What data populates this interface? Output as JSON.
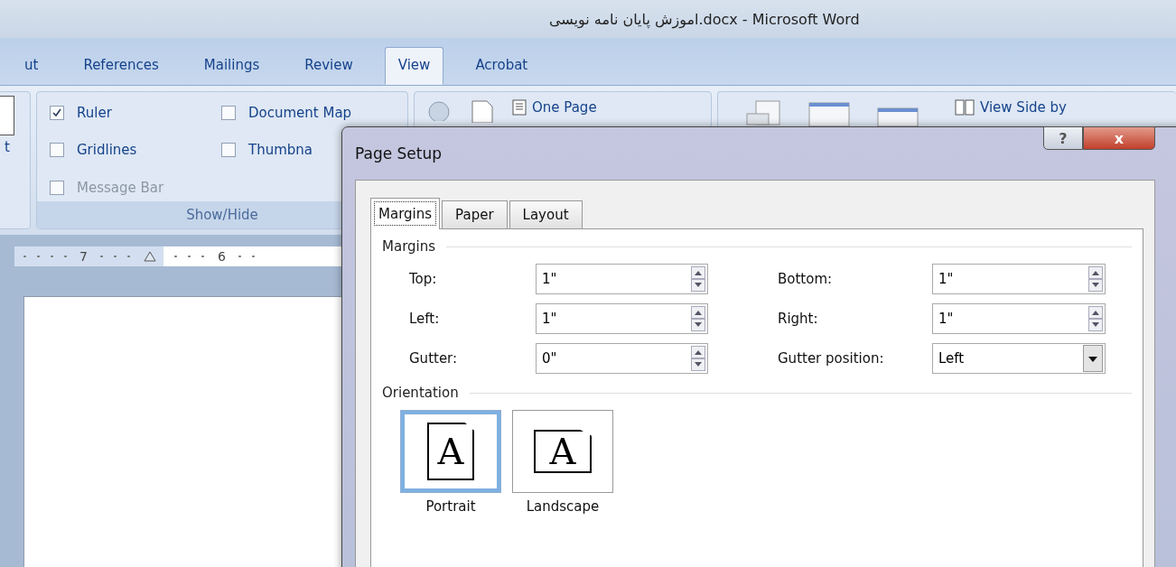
{
  "window": {
    "title": "اموزش پایان نامه نویسی.docx - Microsoft Word"
  },
  "ribbon_tabs": [
    {
      "label": "ut",
      "selected": false
    },
    {
      "label": "References",
      "selected": false
    },
    {
      "label": "Mailings",
      "selected": false
    },
    {
      "label": "Review",
      "selected": false
    },
    {
      "label": "View",
      "selected": true
    },
    {
      "label": "Acrobat",
      "selected": false
    }
  ],
  "left_group": {
    "label": "t"
  },
  "show_hide": {
    "label": "Show/Hide",
    "options": [
      {
        "label": "Ruler",
        "checked": true,
        "disabled": false
      },
      {
        "label": "Document Map",
        "checked": false,
        "disabled": false
      },
      {
        "label": "Gridlines",
        "checked": false,
        "disabled": false
      },
      {
        "label": "Thumbna",
        "checked": false,
        "disabled": false
      },
      {
        "label": "Message Bar",
        "checked": false,
        "disabled": true
      }
    ]
  },
  "zoom_group": {
    "one_page": "One Page"
  },
  "window_group": {
    "view_side_by_side": "View Side by"
  },
  "ruler": {
    "labels": [
      "7",
      "6"
    ]
  },
  "dialog": {
    "title": "Page Setup",
    "help": "?",
    "close": "x",
    "tabs": [
      {
        "label": "Margins",
        "selected": true
      },
      {
        "label": "Paper",
        "selected": false
      },
      {
        "label": "Layout",
        "selected": false
      }
    ],
    "margins_heading": "Margins",
    "fields": [
      {
        "label": "Top:",
        "value": "1\"",
        "kind": "spin"
      },
      {
        "label": "Bottom:",
        "value": "1\"",
        "kind": "spin"
      },
      {
        "label": "Left:",
        "value": "1\"",
        "kind": "spin"
      },
      {
        "label": "Right:",
        "value": "1\"",
        "kind": "spin"
      },
      {
        "label": "Gutter:",
        "value": "0\"",
        "kind": "spin"
      },
      {
        "label": "Gutter position:",
        "value": "Left",
        "kind": "dropdown"
      }
    ],
    "orientation_heading": "Orientation",
    "orientations": [
      {
        "label": "Portrait",
        "kind": "portrait",
        "selected": true,
        "glyph": "A"
      },
      {
        "label": "Landscape",
        "kind": "landscape",
        "selected": false,
        "glyph": "A"
      }
    ]
  }
}
